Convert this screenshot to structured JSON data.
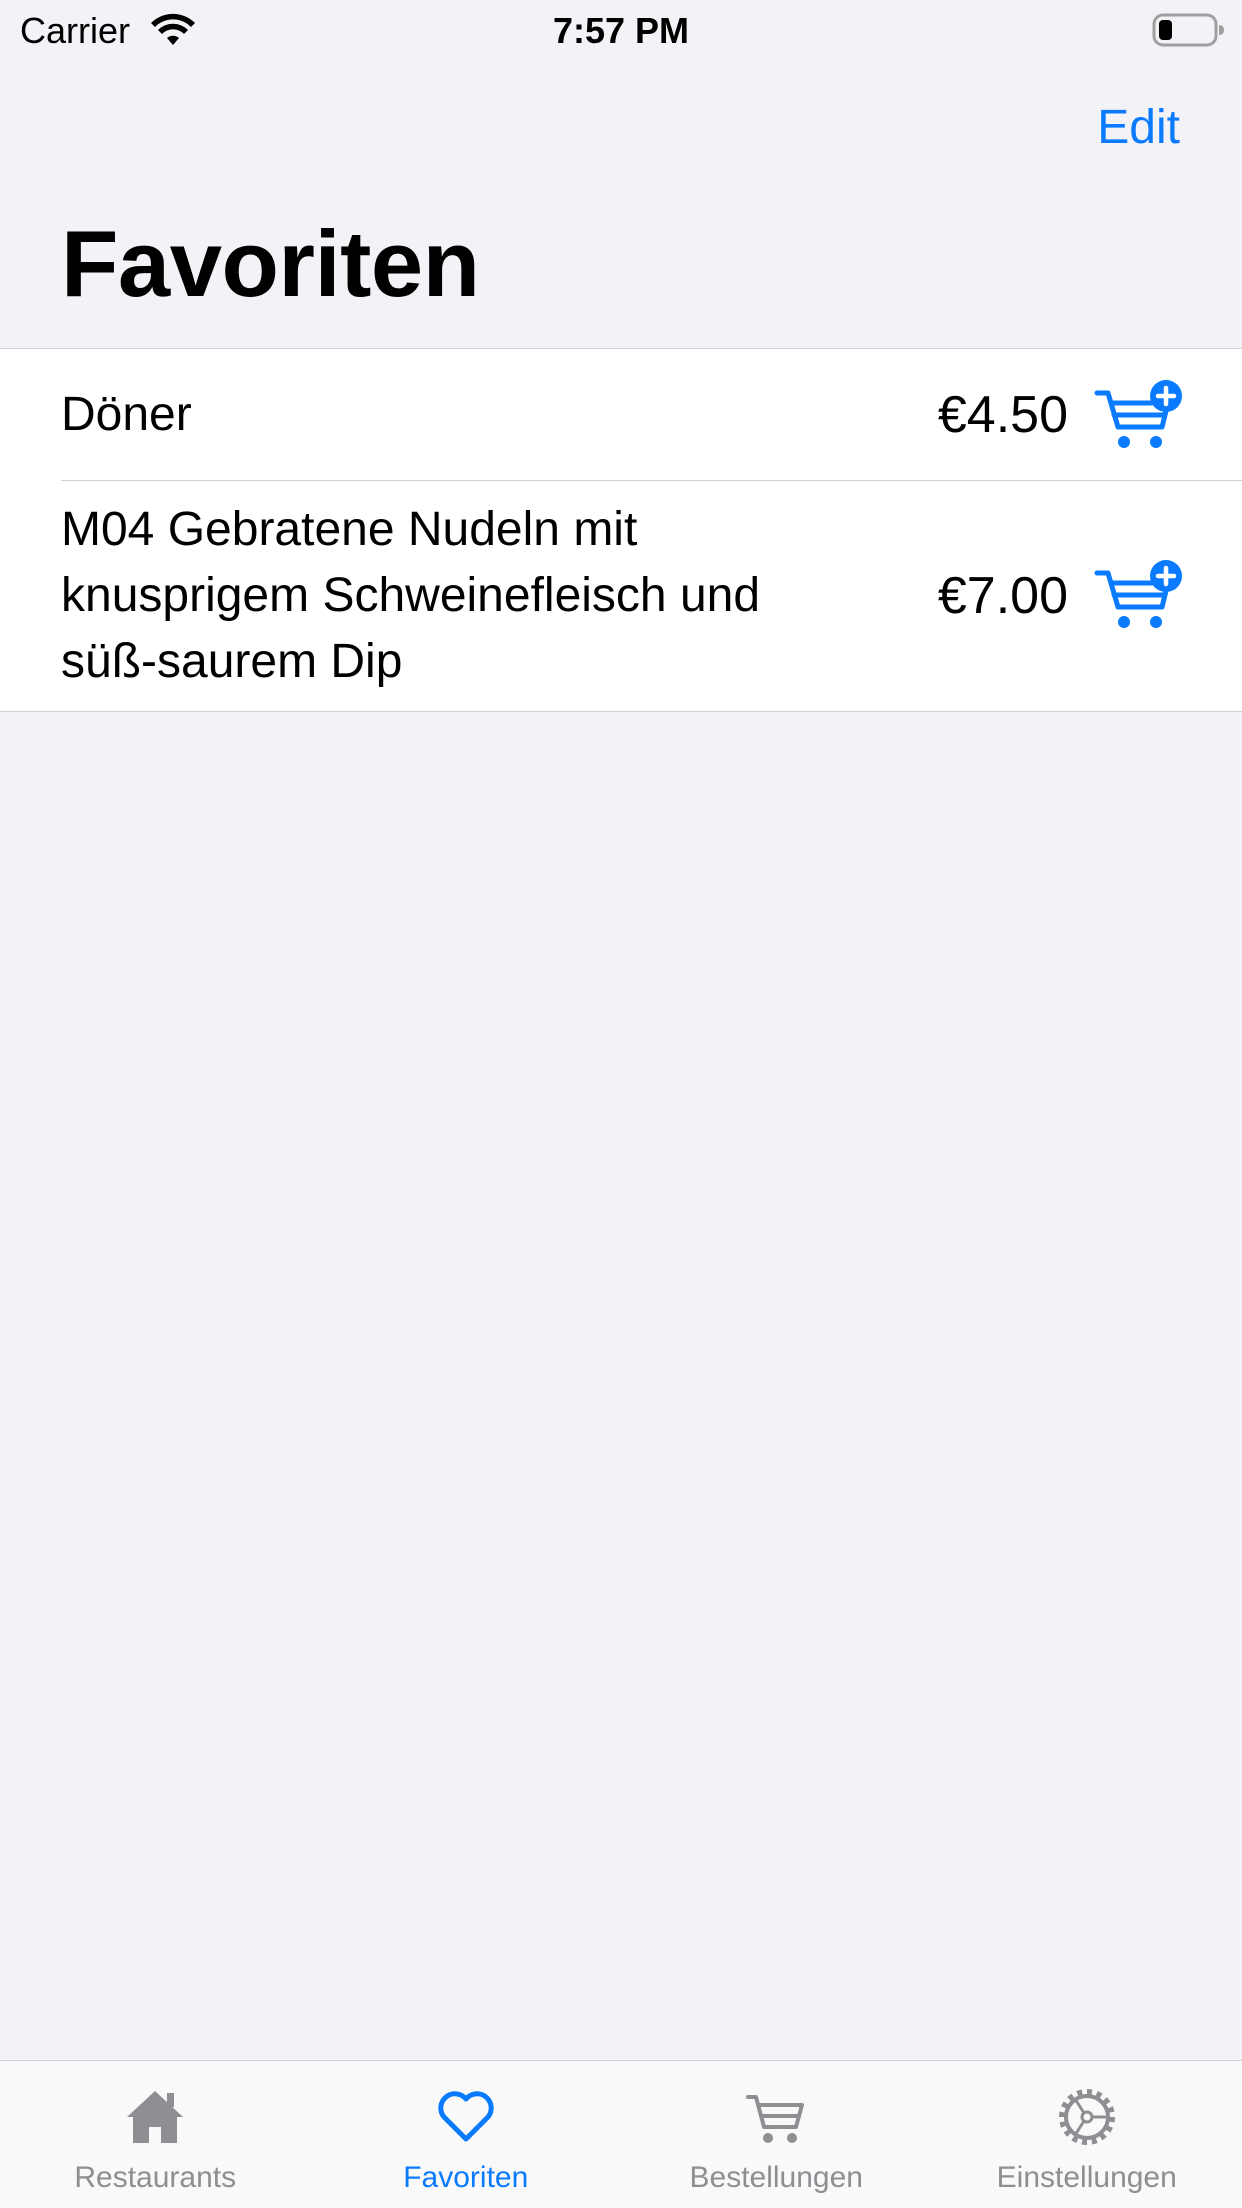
{
  "status_bar": {
    "carrier": "Carrier",
    "time": "7:57 PM",
    "wifi_icon": "wifi-icon",
    "battery_icon": "battery-icon"
  },
  "nav": {
    "edit_label": "Edit",
    "title": "Favoriten"
  },
  "favorites": [
    {
      "name": "Döner",
      "price": "€4.50",
      "icon": "cart-add-icon"
    },
    {
      "name": "M04 Gebratene Nudeln mit knusprigem Schweinefleisch und süß-saurem Dip",
      "price": "€7.00",
      "icon": "cart-add-icon"
    }
  ],
  "tab_bar": {
    "tabs": [
      {
        "label": "Restaurants",
        "icon": "house-icon",
        "active": false
      },
      {
        "label": "Favoriten",
        "icon": "heart-icon",
        "active": true
      },
      {
        "label": "Bestellungen",
        "icon": "cart-icon",
        "active": false
      },
      {
        "label": "Einstellungen",
        "icon": "gear-icon",
        "active": false
      }
    ]
  },
  "colors": {
    "accent": "#0a7aff",
    "inactive": "#8e8e93",
    "background": "#f2f2f7"
  }
}
